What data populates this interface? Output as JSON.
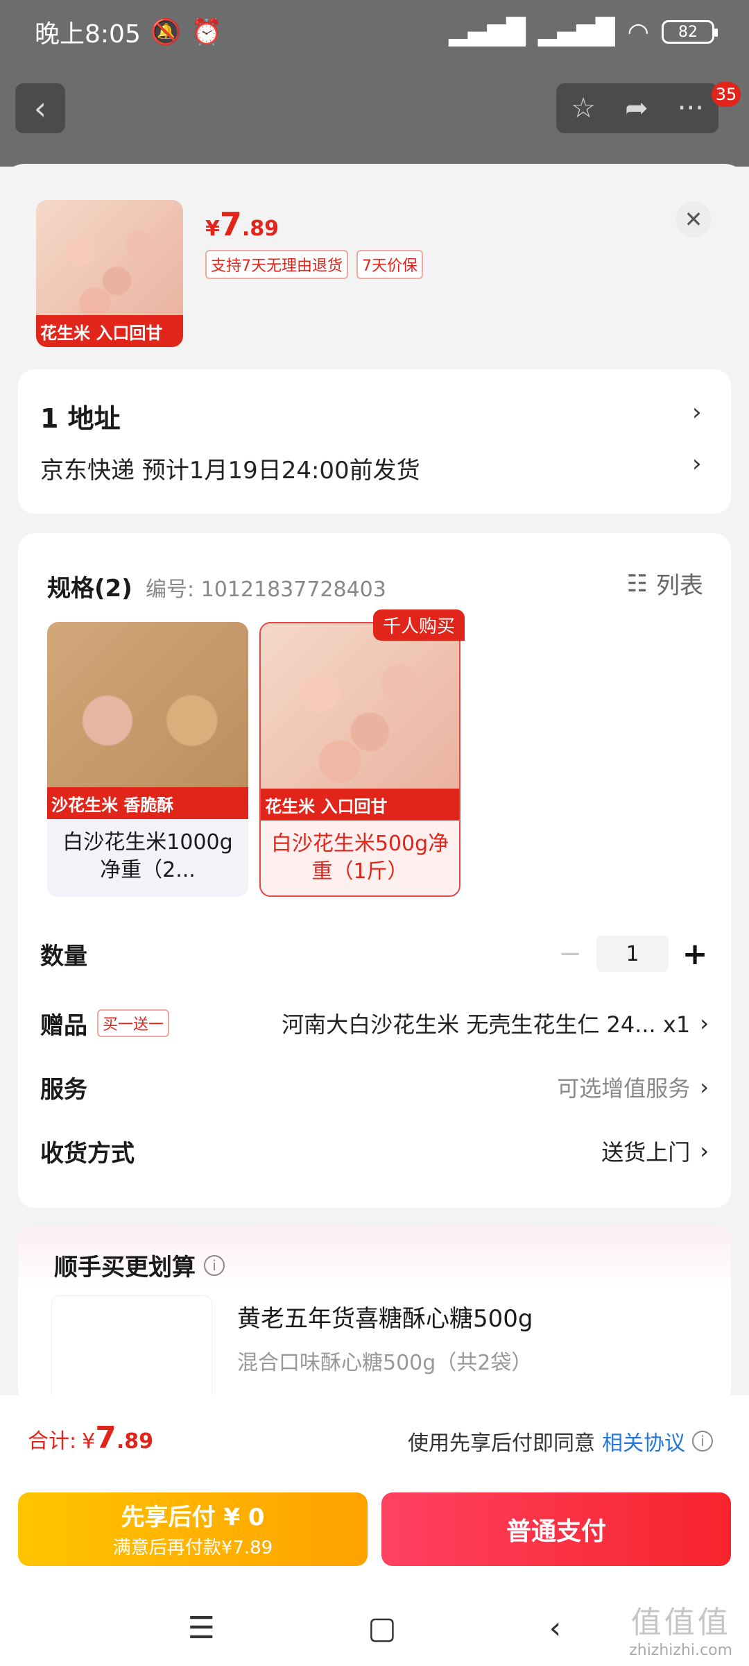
{
  "status_bar": {
    "time": "晚上8:05",
    "battery": "82"
  },
  "top_nav": {
    "badge_count": "35"
  },
  "product": {
    "price_symbol": "¥",
    "price_int": "7",
    "price_dec": ".89",
    "tags": [
      "支持7天无理由退货",
      "7天价保"
    ],
    "thumb_text": "花生米 入口回甘"
  },
  "address": {
    "title": "1  地址",
    "delivery": "京东快递 预计1月19日24:00前发货"
  },
  "spec": {
    "title": "规格(2)",
    "code": "编号: 10121837728403",
    "list_label": "列表",
    "hot_badge": "千人购买",
    "options": [
      {
        "label": "白沙花生米1000g净重（2...",
        "stripe": "沙花生米 香脆酥",
        "selected": false
      },
      {
        "label": "白沙花生米500g净重（1斤）",
        "stripe": "花生米 入口回甘",
        "selected": true
      }
    ]
  },
  "quantity": {
    "label": "数量",
    "minus": "−",
    "value": "1",
    "plus": "+"
  },
  "gift": {
    "label": "赠品",
    "tag": "买一送一",
    "value": "河南大白沙花生米 无壳生花生仁 24... x1"
  },
  "service": {
    "label": "服务",
    "value": "可选增值服务"
  },
  "delivery_method": {
    "label": "收货方式",
    "value": "送货上门"
  },
  "upsell": {
    "title": "顺手买更划算",
    "product_name": "黄老五年货喜糖酥心糖500g",
    "product_desc": "混合口味酥心糖500g（共2袋）"
  },
  "footer": {
    "total_label": "合计:",
    "total_symbol": "¥",
    "total_int": "7",
    "total_dec": ".89",
    "agree_text": "使用先享后付即同意",
    "agree_link": "相关协议",
    "btn_later_line1": "先享后付 ¥ 0",
    "btn_later_line2": "满意后再付款¥7.89",
    "btn_pay": "普通支付"
  },
  "watermark": {
    "text": "值值值",
    "site": "zhizhizhi.com"
  },
  "colors": {
    "accent_red": "#e1251b",
    "link_blue": "#2476d8",
    "later_yellow": "#ffb300"
  }
}
